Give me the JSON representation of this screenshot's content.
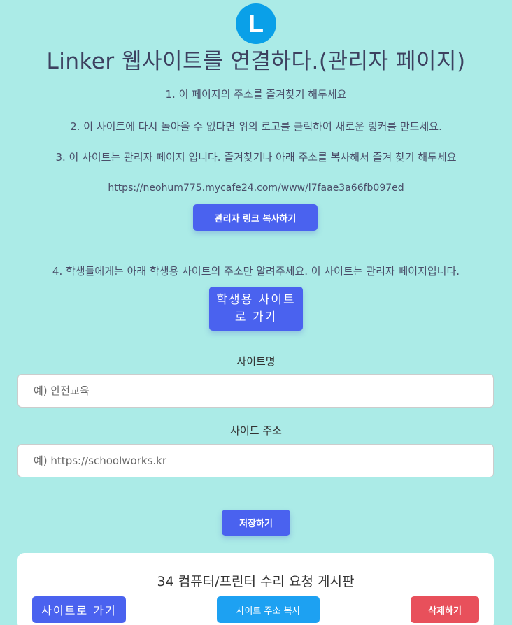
{
  "logo": {
    "letter": "L",
    "color": "#0aa0e8"
  },
  "title": "Linker 웹사이트를 연결하다.(관리자 페이지)",
  "steps": [
    "1. 이 페이지의 주소를 즐겨찾기 해두세요",
    "2. 이 사이트에 다시 돌아올 수 없다면 위의 로고를 클릭하여 새로운 링커를 만드세요.",
    "3. 이 사이트는 관리자 페이지 입니다. 즐겨찾기나 아래 주소를 복사해서 즐겨 찾기 해두세요"
  ],
  "admin_url": "https://neohum775.mycafe24.com/www/l7faae3a66fb097ed",
  "admin_copy_button": "관리자 링크 복사하기",
  "step4": "4. 학생들에게는 아래 학생용 사이트의 주소만 알려주세요. 이 사이트는 관리자 페이지입니다.",
  "student_site_button": "학생용 사이트로 가기",
  "form": {
    "site_name_label": "사이트명",
    "site_name_placeholder": "예) 안전교육",
    "site_url_label": "사이트 주소",
    "site_url_placeholder": "예) https://schoolworks.kr",
    "save_button": "저장하기"
  },
  "site_card": {
    "title": "34 컴퓨터/프린터 수리 요청 게시판",
    "go_button": "사이트로 가기",
    "copy_button": "사이트 주소 복사",
    "delete_button": "삭제하기"
  },
  "colors": {
    "background": "#abebe7",
    "primary": "#4a62ef",
    "info": "#1da1f2",
    "danger": "#e8505b"
  }
}
